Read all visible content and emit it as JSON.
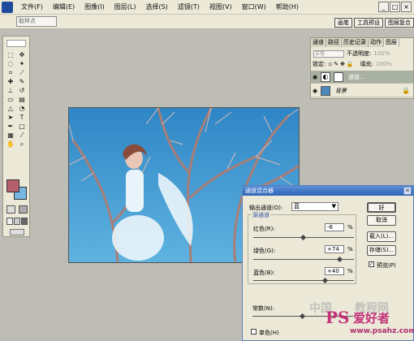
{
  "menu": [
    "文件(F)",
    "编辑(E)",
    "图像(I)",
    "图层(L)",
    "选择(S)",
    "滤镜(T)",
    "视图(V)",
    "窗口(W)",
    "帮助(H)"
  ],
  "window_controls": [
    "_",
    "□",
    "×"
  ],
  "options_bar": {
    "sample_select": "取样点"
  },
  "top_tabs": [
    "画笔",
    "工具预设",
    "图层复合"
  ],
  "layers_panel": {
    "tabs": [
      "通道",
      "路径",
      "历史记录",
      "动作",
      "图层"
    ],
    "blend_mode": "正常",
    "opacity_label": "不透明度:",
    "opacity_value": "100%",
    "lock_label": "锁定:",
    "fill_label": "填充:",
    "fill_value": "100%",
    "layers": [
      {
        "name": "通道..."
      },
      {
        "name": "背景"
      }
    ]
  },
  "dialog": {
    "title": "通道混合器",
    "output_label": "输出通道(O):",
    "output_value": "蓝",
    "source_group": "源通道",
    "channels": [
      {
        "label": "红色(R):",
        "value": "-6"
      },
      {
        "label": "绿色(G):",
        "value": "+74"
      },
      {
        "label": "蓝色(B):",
        "value": "+40"
      }
    ],
    "constant_label": "常数(N):",
    "mono_label": "单色(H)",
    "buttons": [
      "好",
      "取消",
      "载入(L)...",
      "存储(S)..."
    ],
    "preview_label": "预览(P)",
    "preview_checked": "✓"
  },
  "watermarks": [
    "PS",
    "爱好者",
    "www.psahz.com",
    "中国",
    "教程网"
  ]
}
